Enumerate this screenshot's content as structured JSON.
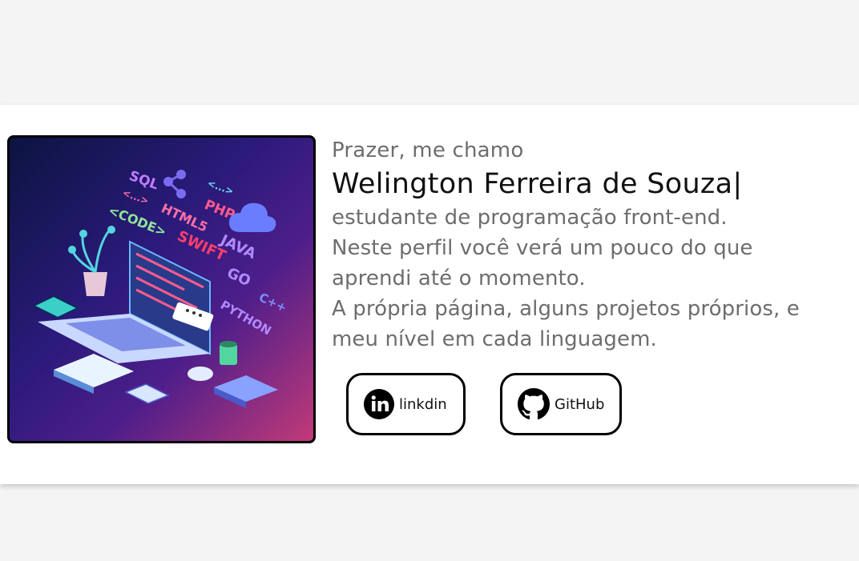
{
  "profile": {
    "greeting": "Prazer, me chamo",
    "name": "Welington Ferreira de Souza",
    "cursor": "|",
    "description_lines": [
      "estudante de programação front-end.",
      "Neste perfil você verá um pouco do que",
      "aprendi até o momento.",
      "A própria página, alguns projetos próprios, e",
      "meu nível em cada linguagem."
    ]
  },
  "buttons": {
    "linkedin": {
      "label": "linkdin",
      "icon": "linkedin-icon"
    },
    "github": {
      "label": "GitHub",
      "icon": "github-icon"
    }
  },
  "illustration": {
    "labels": [
      "SQL",
      "<...>",
      "<CODE>",
      "HTML5",
      "PHP",
      "SWIFT",
      "JAVA",
      "GO",
      "C++",
      "PYTHON",
      "<...>"
    ]
  }
}
